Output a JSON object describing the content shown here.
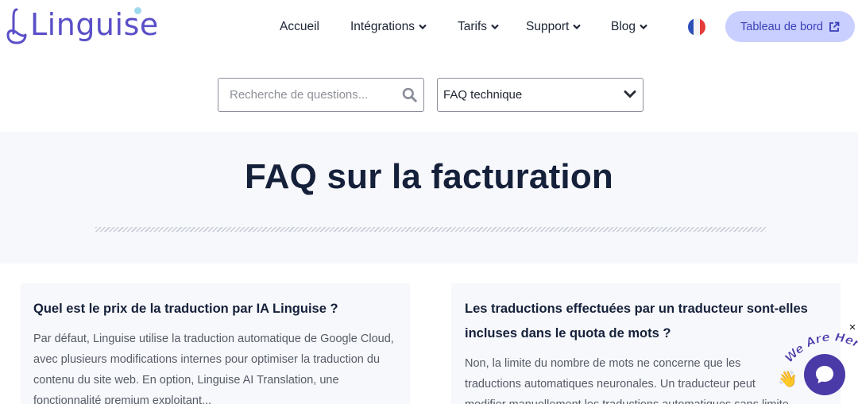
{
  "brand": {
    "name": "Linguise"
  },
  "nav": {
    "items": [
      {
        "label": "Accueil",
        "dropdown": false
      },
      {
        "label": "Intégrations",
        "dropdown": true
      },
      {
        "label": "Tarifs",
        "dropdown": true
      },
      {
        "label": "Support",
        "dropdown": true
      },
      {
        "label": "Blog",
        "dropdown": true
      }
    ],
    "language_flag": "flag-fr-icon",
    "dashboard_label": "Tableau de bord"
  },
  "search": {
    "placeholder": "Recherche de questions...",
    "value": ""
  },
  "category_select": {
    "selected": "FAQ technique"
  },
  "hero": {
    "title": "FAQ sur la facturation"
  },
  "faq": [
    {
      "question": "Quel est le prix de la traduction par IA Linguise ?",
      "answer": "Par défaut, Linguise utilise la traduction automatique de Google Cloud, avec plusieurs modifications internes pour optimiser la traduction du contenu du site web. En option, Linguise AI Translation, une fonctionnalité premium exploitant..."
    },
    {
      "question": "Les traductions effectuées par un traducteur sont-elles incluses dans le quota de mots ?",
      "answer": "Non, la limite du nombre de mots ne concerne que les traductions automatiques neuronales. Un traducteur peut modifier manuellement les traductions automatiques sans limite"
    }
  ],
  "chat": {
    "ribbon_text": "We Are Here!",
    "close_label": "×"
  },
  "colors": {
    "brand": "#5a4fc8",
    "dashboard_bg": "#c9d0ff",
    "dashboard_text": "#3b3fb8",
    "heading": "#15203a",
    "band_bg": "#f7f8fb",
    "chat": "#4a3aa8"
  }
}
